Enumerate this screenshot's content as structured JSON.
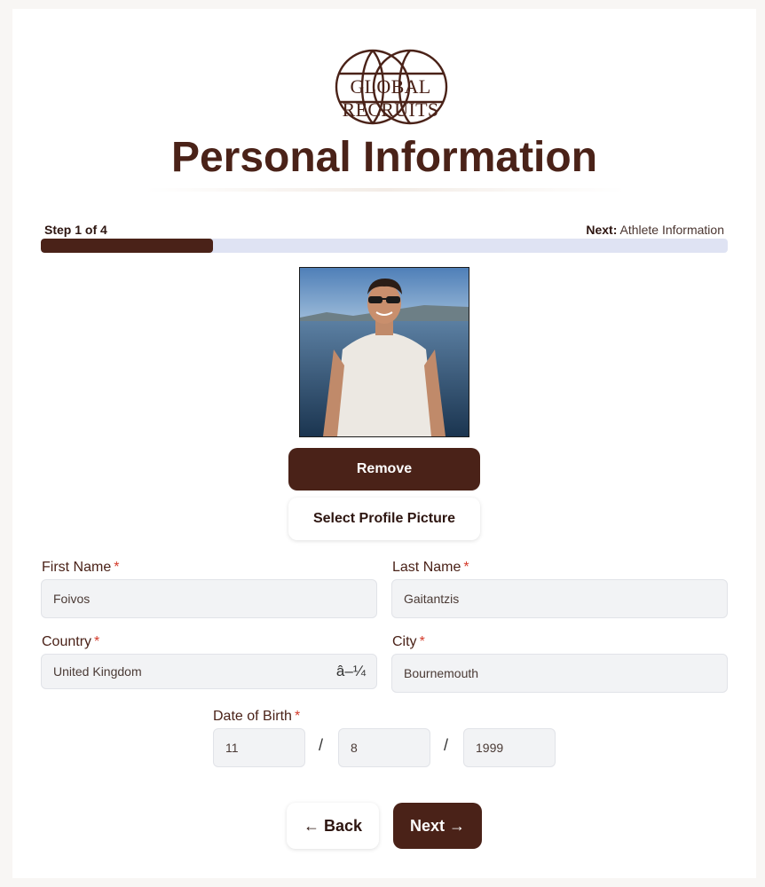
{
  "brand": {
    "logo_text": "GLOBAL RECRUITS"
  },
  "page": {
    "title": "Personal Information"
  },
  "progress": {
    "step_label": "Step 1 of 4",
    "next_prefix": "Next:",
    "next_section": "Athlete Information",
    "fraction": 0.25
  },
  "profile": {
    "remove_label": "Remove",
    "select_label": "Select Profile Picture"
  },
  "form": {
    "first_name": {
      "label": "First Name",
      "value": "Foivos"
    },
    "last_name": {
      "label": "Last Name",
      "value": "Gaitantzis"
    },
    "country": {
      "label": "Country",
      "value": "United Kingdom",
      "caret": "â–¼"
    },
    "city": {
      "label": "City",
      "value": "Bournemouth"
    },
    "dob": {
      "label": "Date of Birth",
      "day": "11",
      "month": "8",
      "year": "1999",
      "separator": "/"
    },
    "required_mark": "*"
  },
  "nav": {
    "back_label": "← Back",
    "next_label": "Next →"
  },
  "colors": {
    "primary": "#4a2218",
    "progress_track": "#dfe3f3",
    "required": "#d43a2a"
  }
}
